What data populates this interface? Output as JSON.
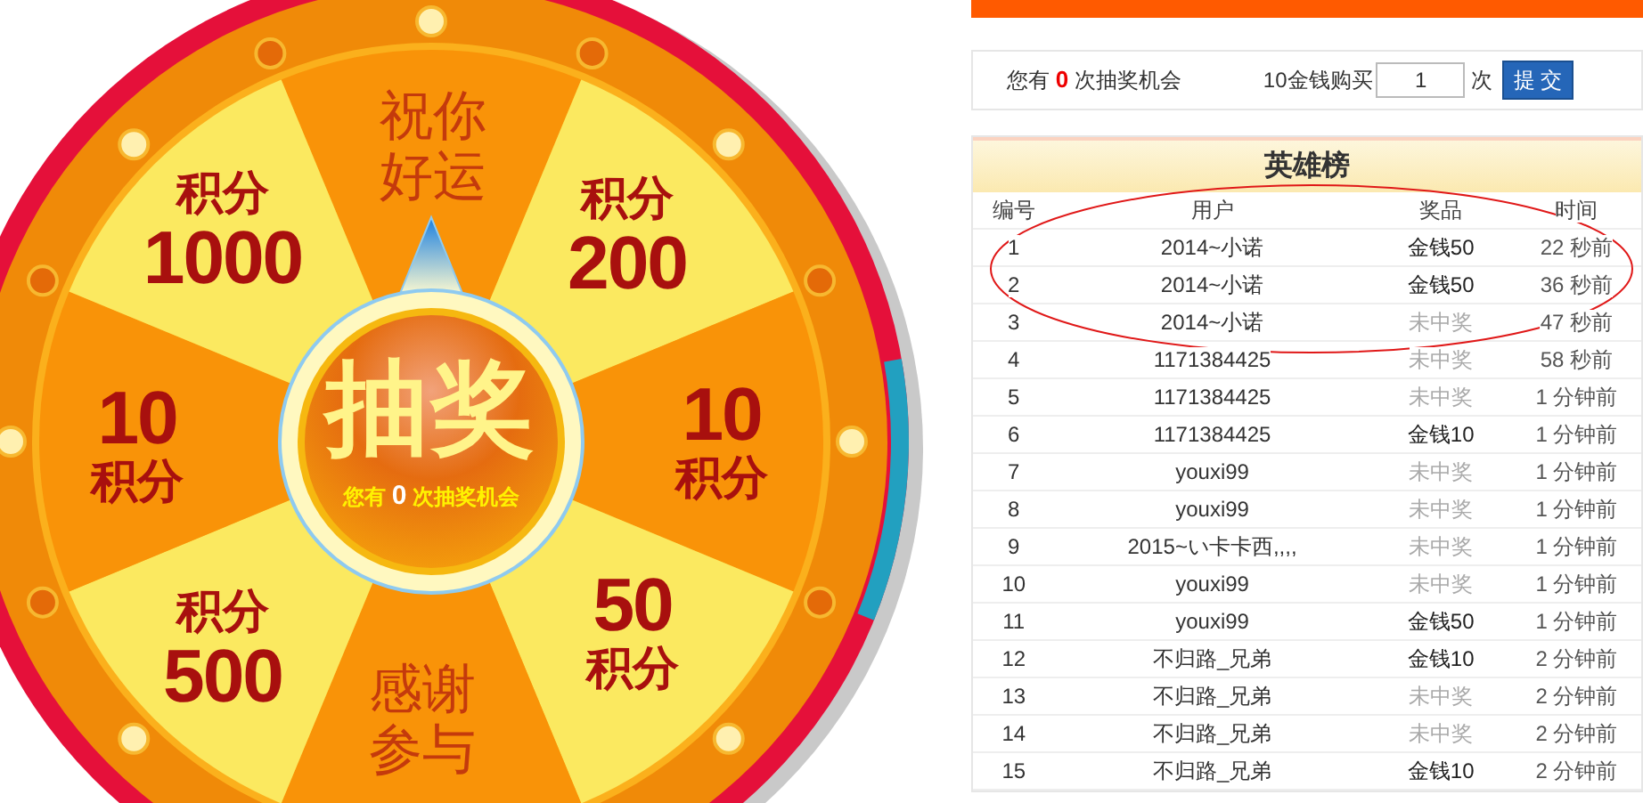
{
  "wheel": {
    "prizes": [
      {
        "kind": "text",
        "lines": [
          "祝你",
          "好运"
        ]
      },
      {
        "kind": "points_top",
        "lines": [
          "积分",
          "200"
        ]
      },
      {
        "kind": "points_bottom",
        "lines": [
          "10",
          "积分"
        ]
      },
      {
        "kind": "points_bottom",
        "lines": [
          "50",
          "积分"
        ]
      },
      {
        "kind": "text",
        "lines": [
          "感谢",
          "参与"
        ]
      },
      {
        "kind": "points_top",
        "lines": [
          "积分",
          "500"
        ]
      },
      {
        "kind": "points_bottom",
        "lines": [
          "10",
          "积分"
        ]
      },
      {
        "kind": "points_top",
        "lines": [
          "积分",
          "1000"
        ]
      }
    ],
    "button": {
      "label": "抽奖",
      "prefix": "您有",
      "count": "0",
      "suffix": "次抽奖机会"
    }
  },
  "chances": {
    "prefix": "您有",
    "count": "0",
    "suffix": "次抽奖机会"
  },
  "purchase": {
    "label": "10金钱购买",
    "value": "1",
    "unit": "次",
    "submit": "提 交"
  },
  "board": {
    "title": "英雄榜",
    "columns": [
      "编号",
      "用户",
      "奖品",
      "时间"
    ],
    "rows": [
      {
        "no": "1",
        "user": "2014~小诺",
        "prize": "金钱50",
        "won": true,
        "time": "22 秒前"
      },
      {
        "no": "2",
        "user": "2014~小诺",
        "prize": "金钱50",
        "won": true,
        "time": "36 秒前"
      },
      {
        "no": "3",
        "user": "2014~小诺",
        "prize": "未中奖",
        "won": false,
        "time": "47 秒前"
      },
      {
        "no": "4",
        "user": "1171384425",
        "prize": "未中奖",
        "won": false,
        "time": "58 秒前"
      },
      {
        "no": "5",
        "user": "1171384425",
        "prize": "未中奖",
        "won": false,
        "time": "1 分钟前"
      },
      {
        "no": "6",
        "user": "1171384425",
        "prize": "金钱10",
        "won": true,
        "time": "1 分钟前"
      },
      {
        "no": "7",
        "user": "youxi99",
        "prize": "未中奖",
        "won": false,
        "time": "1 分钟前"
      },
      {
        "no": "8",
        "user": "youxi99",
        "prize": "未中奖",
        "won": false,
        "time": "1 分钟前"
      },
      {
        "no": "9",
        "user": "2015~い卡卡西,,,,",
        "prize": "未中奖",
        "won": false,
        "time": "1 分钟前"
      },
      {
        "no": "10",
        "user": "youxi99",
        "prize": "未中奖",
        "won": false,
        "time": "1 分钟前"
      },
      {
        "no": "11",
        "user": "youxi99",
        "prize": "金钱50",
        "won": true,
        "time": "1 分钟前"
      },
      {
        "no": "12",
        "user": "不归路_兄弟",
        "prize": "金钱10",
        "won": true,
        "time": "2 分钟前"
      },
      {
        "no": "13",
        "user": "不归路_兄弟",
        "prize": "未中奖",
        "won": false,
        "time": "2 分钟前"
      },
      {
        "no": "14",
        "user": "不归路_兄弟",
        "prize": "未中奖",
        "won": false,
        "time": "2 分钟前"
      },
      {
        "no": "15",
        "user": "不归路_兄弟",
        "prize": "金钱10",
        "won": true,
        "time": "2 分钟前"
      }
    ]
  }
}
